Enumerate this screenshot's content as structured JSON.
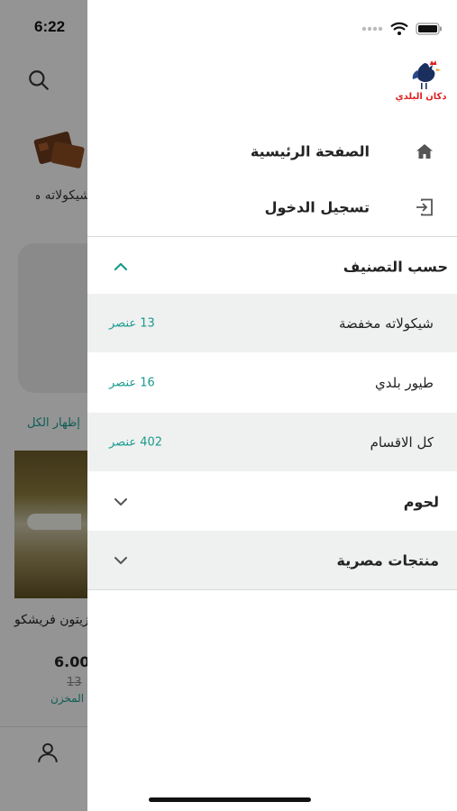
{
  "status_bar": {
    "time": "6:22"
  },
  "background": {
    "category_label": "شيكولاته مخفضة",
    "show_all": "إظهار الكل",
    "product_name": "زيت زيتون فريشكو",
    "price": "6.00",
    "old_price": "13",
    "stock": "متوفر في المخزن"
  },
  "drawer": {
    "nav": [
      {
        "label": "الصفحة الرئيسية",
        "icon": "home-icon"
      },
      {
        "label": "تسجيل الدخول",
        "icon": "login-icon"
      }
    ],
    "by_category": {
      "label": "حسب التصنيف",
      "expanded": true
    },
    "subcategories": [
      {
        "label": "شيكولاته مخفضة",
        "count": "13 عنصر"
      },
      {
        "label": "طيور بلدي",
        "count": "16 عنصر"
      },
      {
        "label": "كل الاقسام",
        "count": "402 عنصر"
      }
    ],
    "groups": [
      {
        "label": "لحوم",
        "icon": "chevron-down-icon"
      },
      {
        "label": "منتجات مصرية",
        "icon": "chevron-down-icon"
      }
    ]
  },
  "colors": {
    "accent": "#1a9b8e",
    "shade": "#eff0f0",
    "overlay": "rgba(0,0,0,0.4)"
  }
}
